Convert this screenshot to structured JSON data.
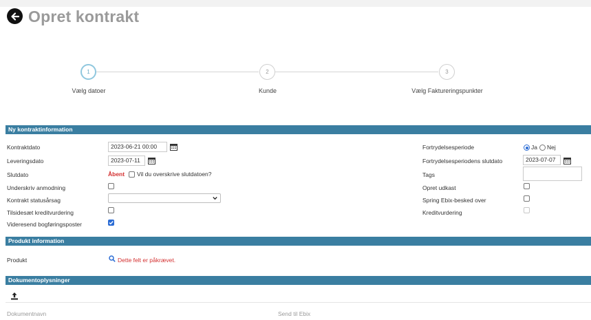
{
  "header": {
    "title": "Opret kontrakt"
  },
  "stepper": {
    "steps": [
      {
        "num": "1",
        "label": "Vælg datoer"
      },
      {
        "num": "2",
        "label": "Kunde"
      },
      {
        "num": "3",
        "label": "Vælg Faktureringspunkter"
      }
    ]
  },
  "sections": {
    "contract": "Ny kontraktinformation",
    "product": "Produkt information",
    "documents": "Dokumentoplysninger"
  },
  "left": {
    "kontraktdato_label": "Kontraktdato",
    "kontraktdato_value": "2023-06-21 00:00",
    "leveringsdato_label": "Leveringsdato",
    "leveringsdato_value": "2023-07-11",
    "slutdato_label": "Slutdato",
    "slutdato_value": "Åbent",
    "overskriv_label": "Vil du overskrive slutdatoen?",
    "underskriv_label": "Underskriv anmodning",
    "statusarsag_label": "Kontrakt statusårsag",
    "statusarsag_value": "",
    "tilsidesaet_label": "Tilsidesæt kreditvurdering",
    "videresend_label": "Videresend bogføringsposter"
  },
  "right": {
    "fortrydelse_label": "Fortrydelsesperiode",
    "ja_label": "Ja",
    "nej_label": "Nej",
    "slutdato_label": "Fortrydelsesperiodens slutdato",
    "slutdato_value": "2023-07-07",
    "tags_label": "Tags",
    "tags_value": "",
    "udkast_label": "Opret udkast",
    "ebix_label": "Spring Ebix-besked over",
    "kredit_label": "Kreditvurdering"
  },
  "product": {
    "label": "Produkt",
    "required": "Dette felt er påkrævet."
  },
  "documents": {
    "col_name": "Dokumentnavn",
    "col_ebix": "Send til Ebix"
  },
  "colors": {
    "accent": "#3a7ea1",
    "error": "#d32f2f"
  }
}
